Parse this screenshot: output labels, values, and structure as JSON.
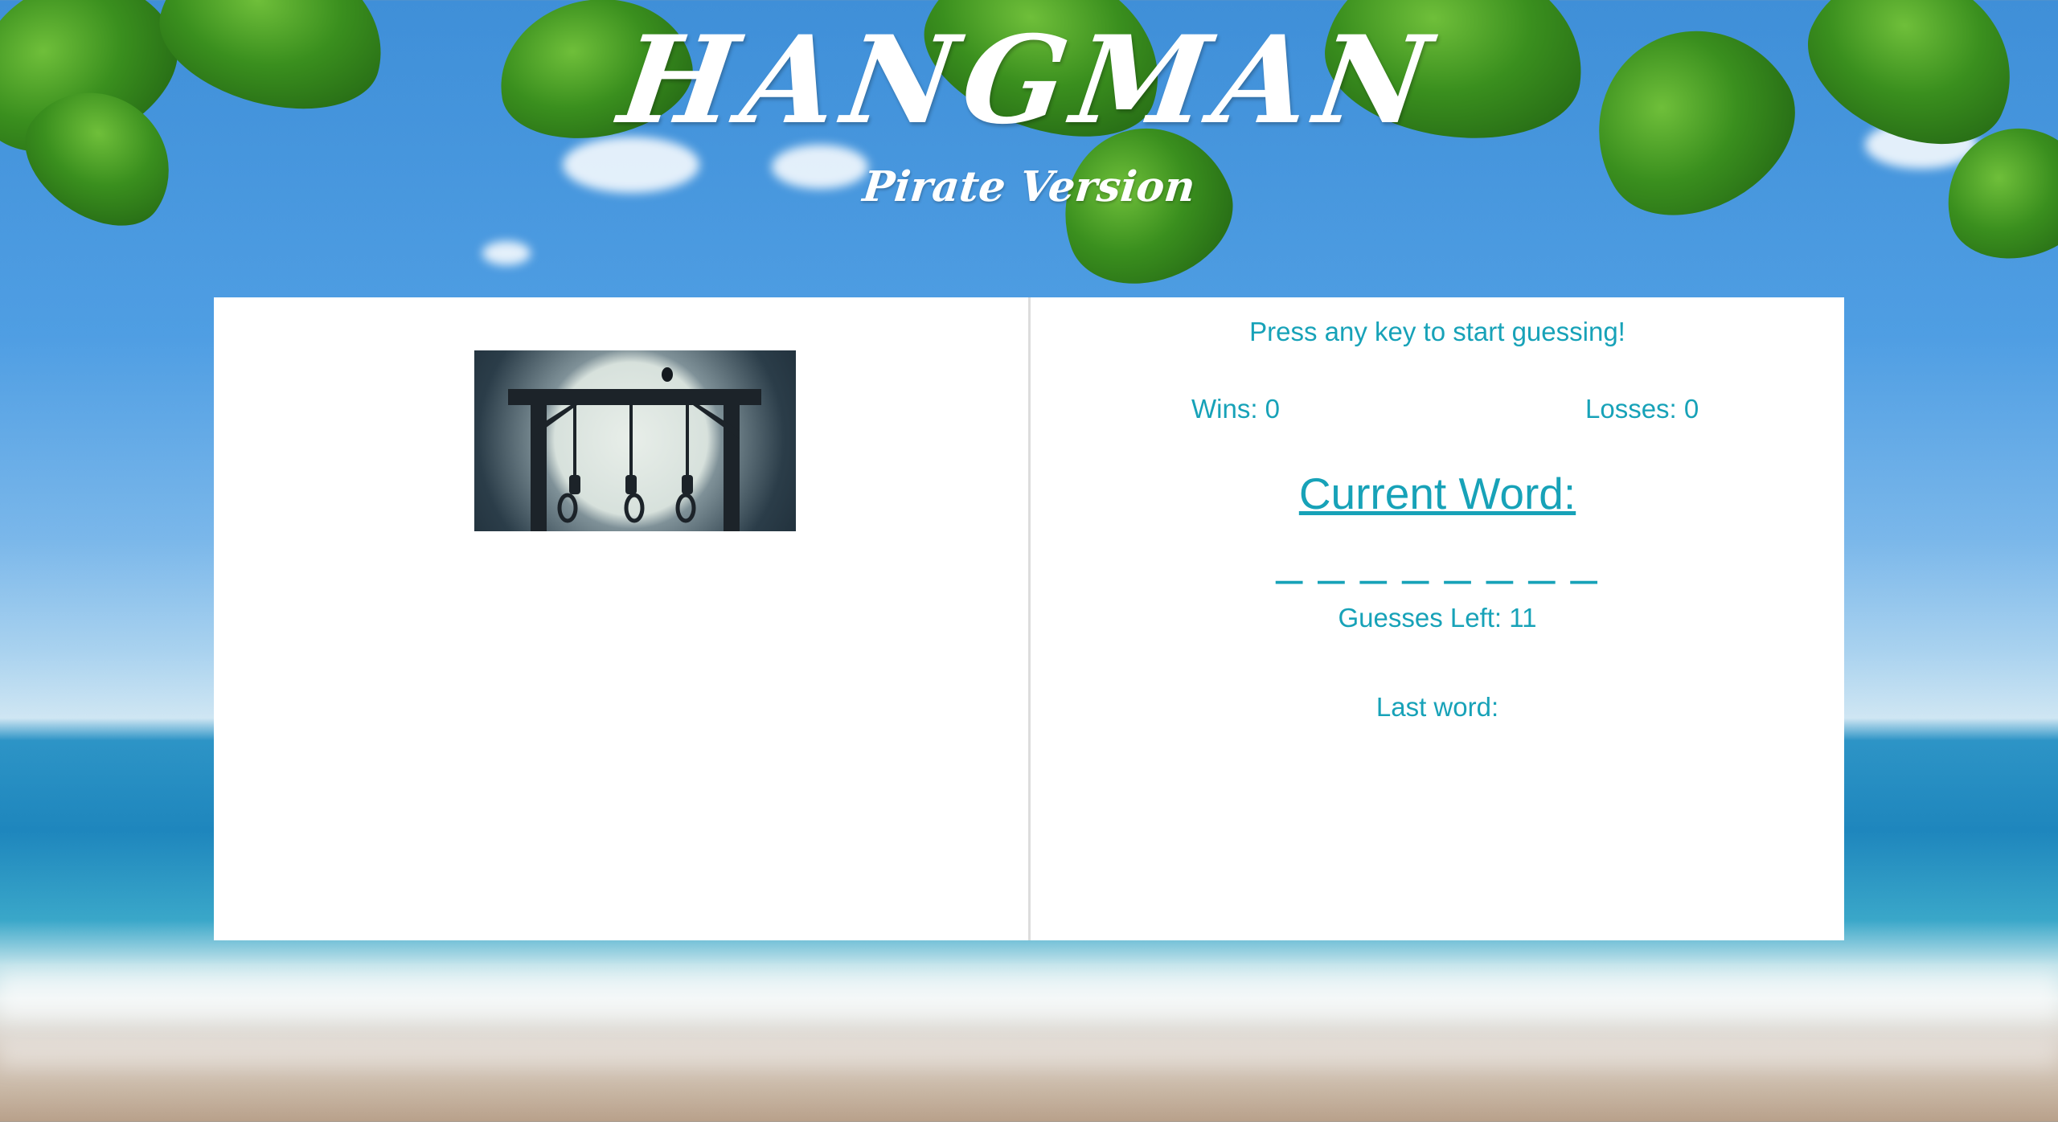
{
  "header": {
    "title": "HANGMAN",
    "subtitle": "Pirate Version"
  },
  "game": {
    "start_message": "Press any key to start guessing!",
    "wins_label": "Wins: 0",
    "losses_label": "Losses: 0",
    "current_word_label": "Current Word:",
    "current_word": "_ _ _ _ _ _ _ _",
    "guesses_left_label": "Guesses Left: 11",
    "last_word_label": "Last word:"
  },
  "colors": {
    "accent": "#17a2b8",
    "panel_bg": "#ffffff"
  }
}
